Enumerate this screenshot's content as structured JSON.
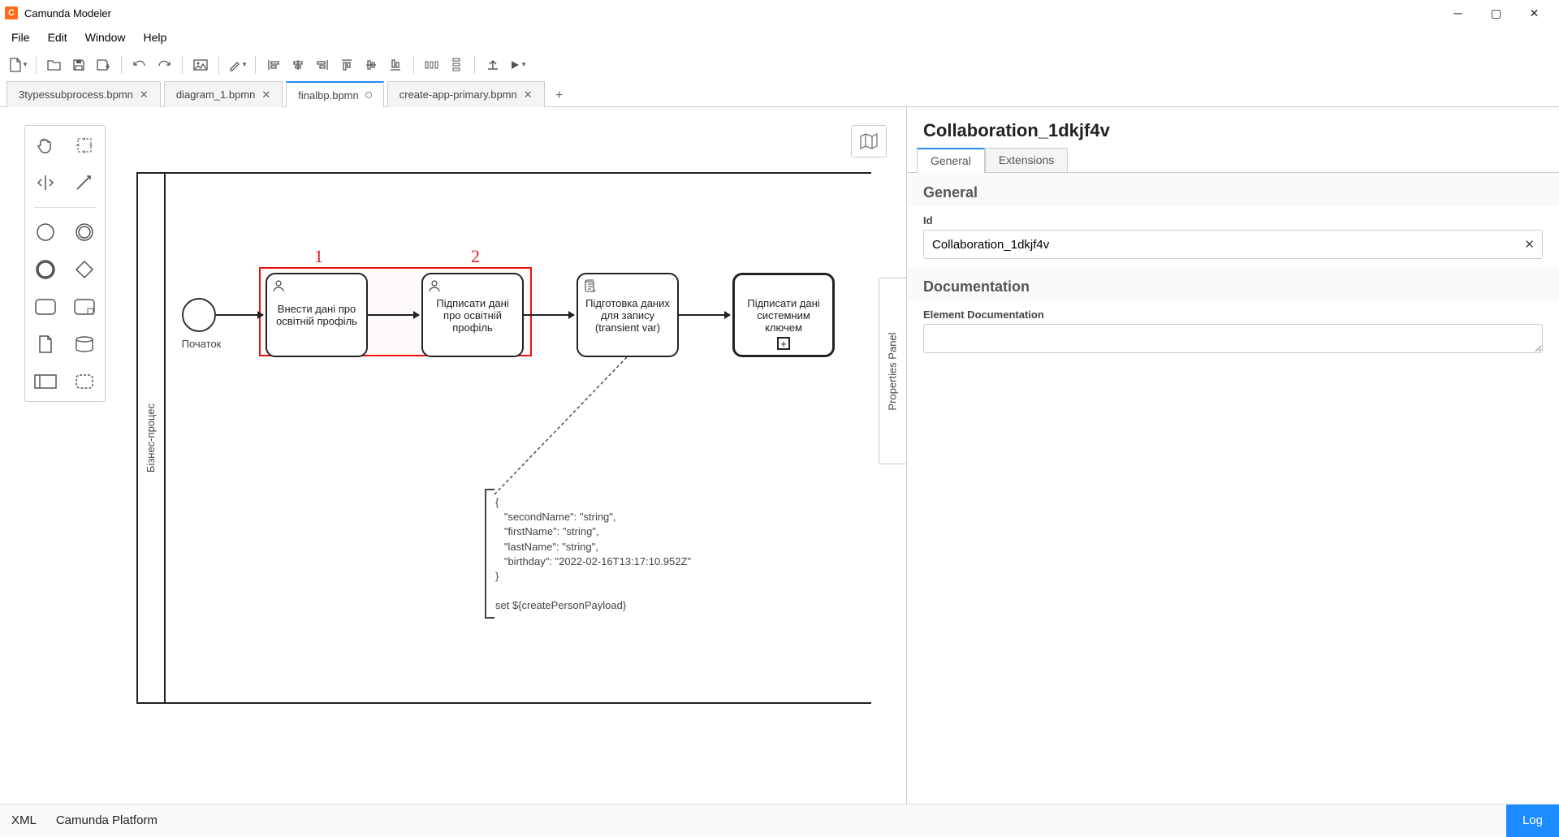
{
  "app": {
    "title": "Camunda Modeler"
  },
  "menu": {
    "file": "File",
    "edit": "Edit",
    "window": "Window",
    "help": "Help"
  },
  "tabs": [
    {
      "label": "3typessubprocess.bpmn",
      "dirty": false
    },
    {
      "label": "diagram_1.bpmn",
      "dirty": false
    },
    {
      "label": "finalbp.bpmn",
      "dirty": true
    },
    {
      "label": "create-app-primary.bpmn",
      "dirty": false
    }
  ],
  "active_tab_index": 2,
  "diagram": {
    "lane_label": "Бізнес-процес",
    "start_label": "Початок",
    "annot1": "1",
    "annot2": "2",
    "task1": "Внести дані про освітній профіль",
    "task2": "Підписати дані про освітній профіль",
    "task3": "Підготовка даних для запису (transient var)",
    "task4": "Підписати дані системним ключем",
    "annotation_text": "{\n   \"secondName\": \"string\",\n   \"firstName\": \"string\",\n   \"lastName\": \"string\",\n   \"birthday\": \"2022-02-16T13:17:10.952Z\"\n}\n\nset ${createPersonPayload}"
  },
  "properties": {
    "panel_label": "Properties Panel",
    "title": "Collaboration_1dkjf4v",
    "tab_general": "General",
    "tab_extensions": "Extensions",
    "section_general": "General",
    "id_label": "Id",
    "id_value": "Collaboration_1dkjf4v",
    "section_documentation": "Documentation",
    "doc_label": "Element Documentation",
    "doc_value": ""
  },
  "bottombar": {
    "xml": "XML",
    "platform": "Camunda Platform",
    "log": "Log"
  }
}
